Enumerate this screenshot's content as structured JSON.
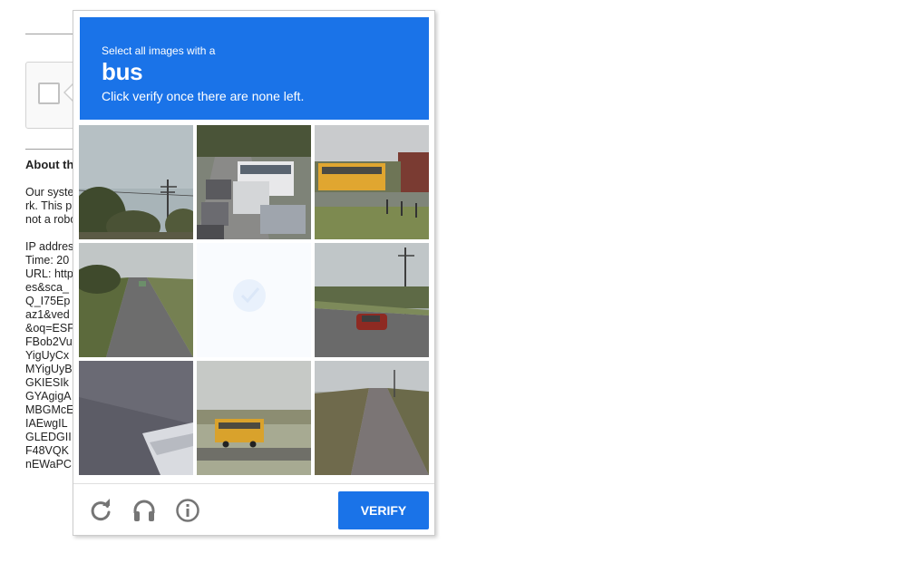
{
  "background": {
    "heading": "About th",
    "paragraph": "Our syste\nrk. This p\nnot a robo",
    "details": "IP addres\nTime: 20\nURL: http\nes&sca_\nQ_I75Ep\naz1&ved\n&oq=ESF\nFBob2Vu\nYigUyCx\nMYigUyB\nGKIESIk\nGYAgigA\nMBGMcE\nIAEwgIL\nGLEDGII\nF48VQK\nnEWaPC"
  },
  "challenge": {
    "instruction_small": "Select all images with a",
    "target_object": "bus",
    "instruction_sub": "Click verify once there are none left.",
    "tiles": [
      {
        "content": "trees and power lines"
      },
      {
        "content": "traffic with white bus"
      },
      {
        "content": "yellow school bus"
      },
      {
        "content": "road with green car"
      },
      {
        "content": "empty (selected/fading)"
      },
      {
        "content": "road with red car"
      },
      {
        "content": "dark surface"
      },
      {
        "content": "yellow school bus on road"
      },
      {
        "content": "highway"
      }
    ],
    "verify_label": "VERIFY",
    "icons": [
      "reload-icon",
      "audio-headphones-icon",
      "info-icon"
    ]
  },
  "colors": {
    "accent": "#1a73e8",
    "icon_gray": "#757575"
  }
}
